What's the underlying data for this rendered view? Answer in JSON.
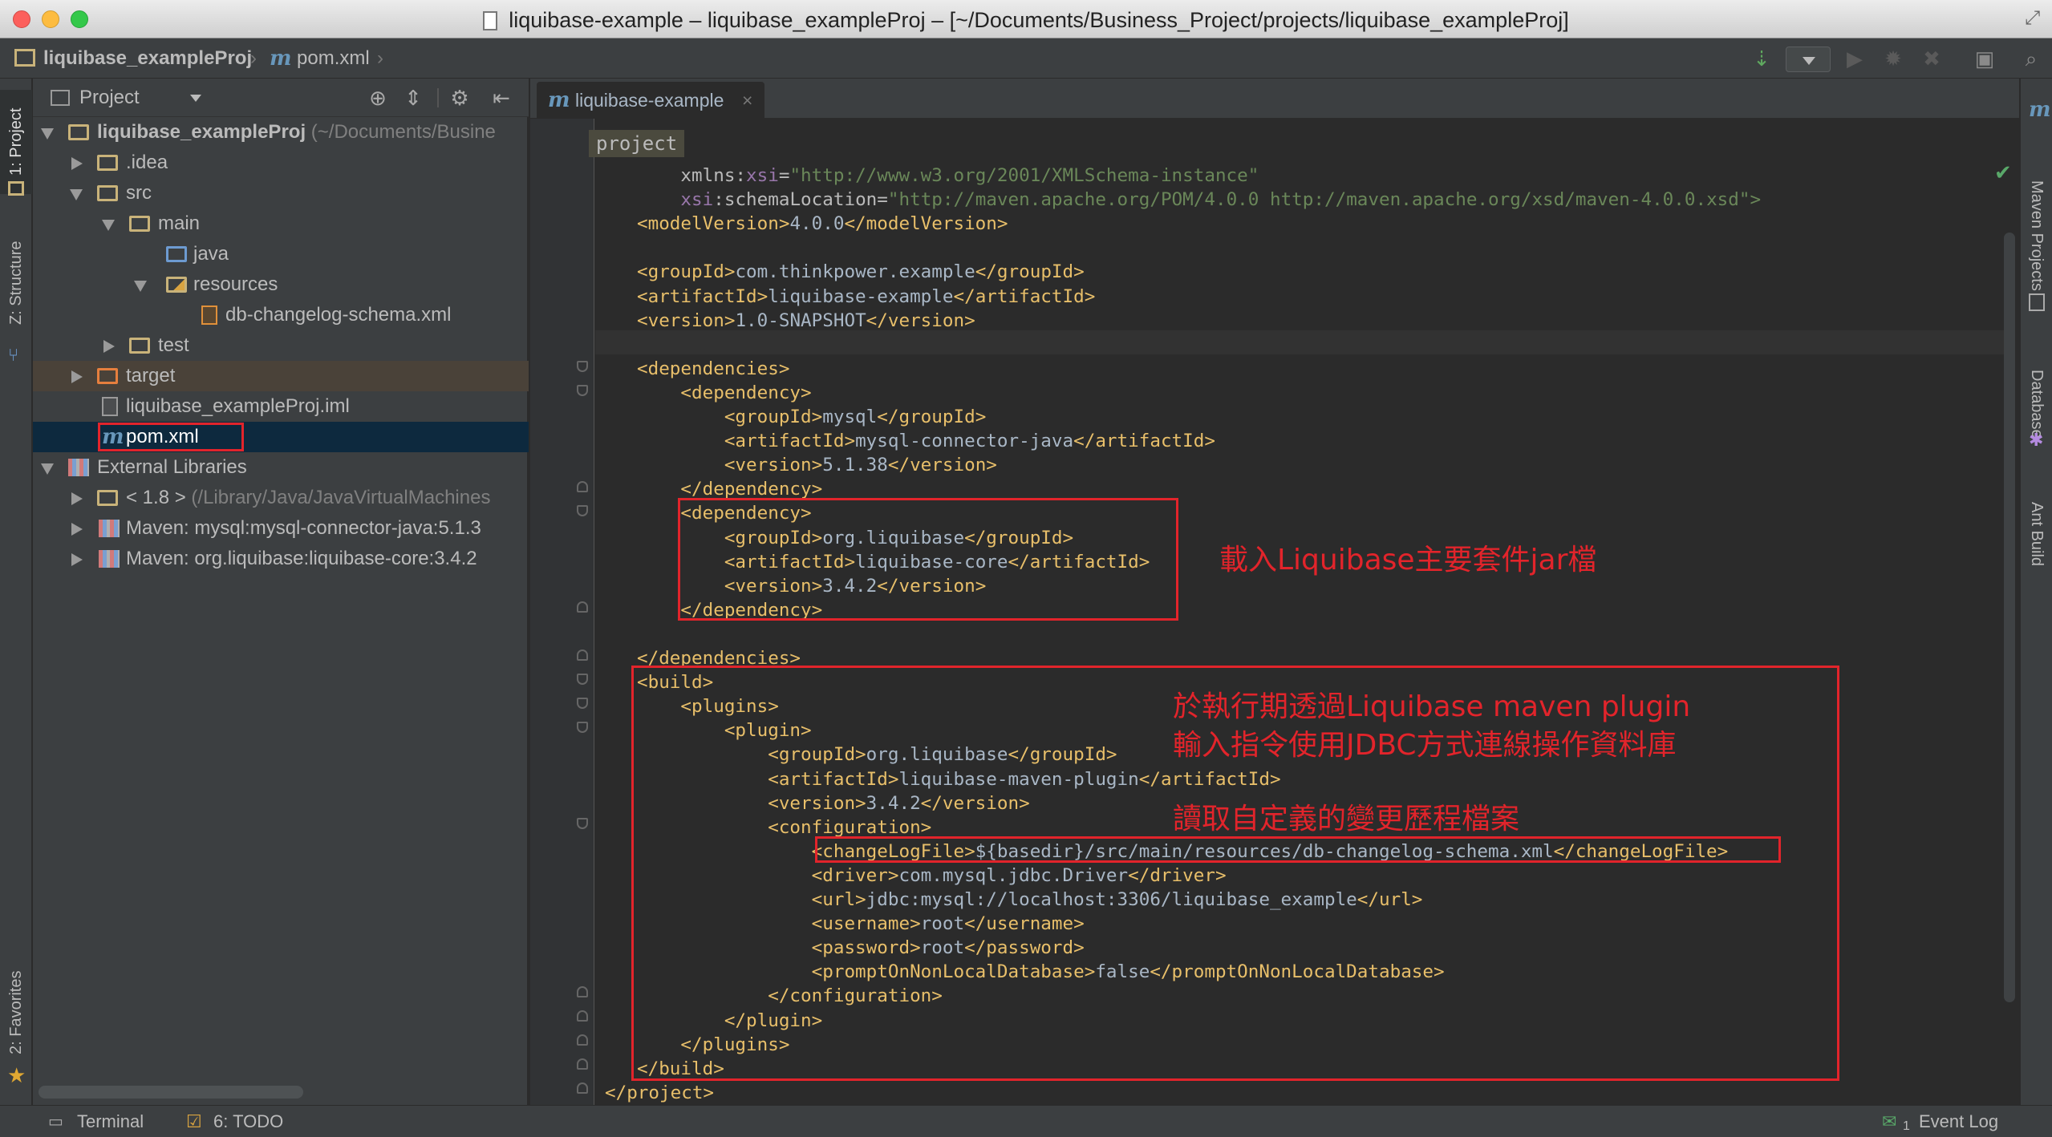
{
  "window": {
    "title": "liquibase-example – liquibase_exampleProj – [~/Documents/Business_Project/projects/liquibase_exampleProj]"
  },
  "navbar": {
    "project": "liquibase_exampleProj",
    "file": "pom.xml"
  },
  "left_strip": {
    "project_tab": "1: Project",
    "structure_tab": "Z: Structure",
    "favorites_tab": "2: Favorites"
  },
  "right_strip": {
    "maven_tab": "Maven Projects",
    "database_tab": "Database",
    "ant_tab": "Ant Build"
  },
  "project_panel": {
    "view_label": "Project",
    "tree": [
      {
        "label": "liquibase_exampleProj",
        "hint": "(~/Documents/Busine"
      },
      {
        "label": ".idea"
      },
      {
        "label": "src"
      },
      {
        "label": "main"
      },
      {
        "label": "java"
      },
      {
        "label": "resources"
      },
      {
        "label": "db-changelog-schema.xml"
      },
      {
        "label": "test"
      },
      {
        "label": "target"
      },
      {
        "label": "liquibase_exampleProj.iml"
      },
      {
        "label": "pom.xml"
      },
      {
        "label": "External Libraries"
      },
      {
        "label": "< 1.8 >",
        "hint": "(/Library/Java/JavaVirtualMachines"
      },
      {
        "label": "Maven: mysql:mysql-connector-java:5.1.3"
      },
      {
        "label": "Maven: org.liquibase:liquibase-core:3.4.2"
      }
    ]
  },
  "editor": {
    "tab_label": "liquibase-example",
    "breadcrumb": "project",
    "lines": [
      {
        "a": "    xmlns:",
        "b": "xsi",
        "c": "=",
        "d": "\"http://www.w3.org/2001/XMLSchema-instance\""
      },
      {
        "a": "    ",
        "b": "xsi",
        "c": ":schemaLocation=",
        "d": "\"http://maven.apache.org/POM/4.0.0 http://maven.apache.org/xsd/maven-4.0.0.xsd\">"
      },
      {
        "t": "<modelVersion>",
        "v": "4.0.0",
        "e": "</modelVersion>"
      },
      {
        "t": "",
        "v": "",
        "e": ""
      },
      {
        "t": "<groupId>",
        "v": "com.thinkpower.example",
        "e": "</groupId>"
      },
      {
        "t": "<artifactId>",
        "v": "liquibase-example",
        "e": "</artifactId>"
      },
      {
        "t": "<version>",
        "v": "1.0-SNAPSHOT",
        "e": "</version>"
      },
      {
        "t": "",
        "v": "",
        "e": ""
      },
      {
        "t": "<dependencies>",
        "v": "",
        "e": ""
      },
      {
        "t": "    <dependency>",
        "v": "",
        "e": ""
      },
      {
        "t": "        <groupId>",
        "v": "mysql",
        "e": "</groupId>"
      },
      {
        "t": "        <artifactId>",
        "v": "mysql-connector-java",
        "e": "</artifactId>"
      },
      {
        "t": "        <version>",
        "v": "5.1.38",
        "e": "</version>"
      },
      {
        "t": "    </dependency>",
        "v": "",
        "e": ""
      },
      {
        "t": "    <dependency>",
        "v": "",
        "e": ""
      },
      {
        "t": "        <groupId>",
        "v": "org.liquibase",
        "e": "</groupId>"
      },
      {
        "t": "        <artifactId>",
        "v": "liquibase-core",
        "e": "</artifactId>"
      },
      {
        "t": "        <version>",
        "v": "3.4.2",
        "e": "</version>"
      },
      {
        "t": "    </dependency>",
        "v": "",
        "e": ""
      },
      {
        "t": "",
        "v": "",
        "e": ""
      },
      {
        "t": "</dependencies>",
        "v": "",
        "e": ""
      },
      {
        "t": "<build>",
        "v": "",
        "e": ""
      },
      {
        "t": "    <plugins>",
        "v": "",
        "e": ""
      },
      {
        "t": "        <plugin>",
        "v": "",
        "e": ""
      },
      {
        "t": "            <groupId>",
        "v": "org.liquibase",
        "e": "</groupId>"
      },
      {
        "t": "            <artifactId>",
        "v": "liquibase-maven-plugin",
        "e": "</artifactId>"
      },
      {
        "t": "            <version>",
        "v": "3.4.2",
        "e": "</version>"
      },
      {
        "t": "            <configuration>",
        "v": "",
        "e": ""
      },
      {
        "t": "                <changeLogFile>",
        "v": "${basedir}/src/main/resources/db-changelog-schema.xml",
        "e": "</changeLogFile>"
      },
      {
        "t": "                <driver>",
        "v": "com.mysql.jdbc.Driver",
        "e": "</driver>"
      },
      {
        "t": "                <url>",
        "v": "jdbc:mysql://localhost:3306/liquibase_example",
        "e": "</url>"
      },
      {
        "t": "                <username>",
        "v": "root",
        "e": "</username>"
      },
      {
        "t": "                <password>",
        "v": "root",
        "e": "</password>"
      },
      {
        "t": "                <promptOnNonLocalDatabase>",
        "v": "false",
        "e": "</promptOnNonLocalDatabase>"
      },
      {
        "t": "            </configuration>",
        "v": "",
        "e": ""
      },
      {
        "t": "        </plugin>",
        "v": "",
        "e": ""
      },
      {
        "t": "    </plugins>",
        "v": "",
        "e": ""
      },
      {
        "t": "</build>",
        "v": "",
        "e": ""
      },
      {
        "t": "</project>",
        "v": "",
        "e": ""
      }
    ]
  },
  "annotations": {
    "core_note": "載入Liquibase主要套件jar檔",
    "plugin_note_1": "於執行期透過Liquibase maven plugin",
    "plugin_note_2": "輸入指令使用JDBC方式連線操作資料庫",
    "changelog_note": "讀取自定義的變更歷程檔案"
  },
  "statusbar": {
    "terminal": "Terminal",
    "todo": "6: TODO",
    "event_log": "Event Log",
    "event_count": "1"
  },
  "colors": {
    "accent_red": "#e2242b",
    "tag": "#e8bf6a",
    "string": "#6a8759",
    "selection": "#0d293e"
  }
}
